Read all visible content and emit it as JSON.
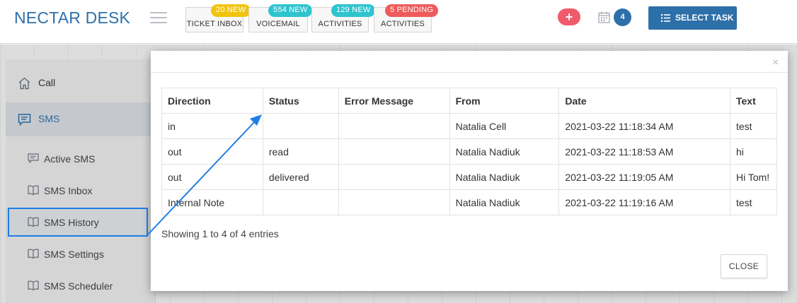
{
  "header": {
    "brand": "NECTAR DESK",
    "buttons": [
      {
        "label": "TICKET INBOX",
        "badge": "20 NEW",
        "badge_color": "#f1c40f"
      },
      {
        "label": "VOICEMAIL",
        "badge": "554 NEW",
        "badge_color": "#2ec4cf"
      },
      {
        "label": "ACTIVITIES",
        "badge": "129 NEW",
        "badge_color": "#2ec4cf"
      },
      {
        "label": "ACTIVITIES",
        "badge": "5 PENDING",
        "badge_color": "#ef5b5b"
      }
    ],
    "plus_label": "+",
    "calendar_count": "4",
    "select_task_label": "SELECT TASK"
  },
  "sidebar": {
    "top_items": [
      {
        "label": "Call",
        "icon": "home-icon"
      },
      {
        "label": "SMS",
        "icon": "chat-icon"
      }
    ],
    "sub_items": [
      {
        "label": "Active SMS",
        "icon": "message-icon"
      },
      {
        "label": "SMS Inbox",
        "icon": "book-icon"
      },
      {
        "label": "SMS History",
        "icon": "book-icon"
      },
      {
        "label": "SMS Settings",
        "icon": "book-icon"
      },
      {
        "label": "SMS Scheduler",
        "icon": "book-icon"
      }
    ]
  },
  "modal": {
    "close_x": "×",
    "table": {
      "columns": [
        "Direction",
        "Status",
        "Error Message",
        "From",
        "Date",
        "Text"
      ],
      "rows": [
        [
          "in",
          "",
          "",
          "Natalia Cell",
          "2021-03-22 11:18:34 AM",
          "test"
        ],
        [
          "out",
          "read",
          "",
          "Natalia Nadiuk",
          "2021-03-22 11:18:53 AM",
          "hi"
        ],
        [
          "out",
          "delivered",
          "",
          "Natalia Nadiuk",
          "2021-03-22 11:19:05 AM",
          "Hi Tom!"
        ],
        [
          "Internal Note",
          "",
          "",
          "Natalia Nadiuk",
          "2021-03-22 11:19:16 AM",
          "test"
        ]
      ]
    },
    "footer_text": "Showing 1 to 4 of 4 entries",
    "close_label": "CLOSE"
  },
  "colors": {
    "brand": "#2d6fa8",
    "annotation": "#1e7ee6"
  }
}
